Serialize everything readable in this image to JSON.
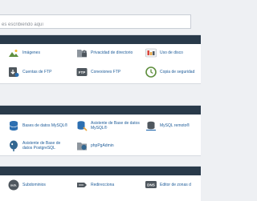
{
  "search": {
    "placeholder": "es escribiendo aquí"
  },
  "files": {
    "items": [
      {
        "label": "Imágenes",
        "icon": "images-icon"
      },
      {
        "label": "Privacidad de directorio",
        "icon": "directory-privacy-icon"
      },
      {
        "label": "Uso de disco",
        "icon": "disk-usage-icon"
      },
      {
        "label": "Cuentas de FTP",
        "icon": "ftp-accounts-icon"
      },
      {
        "label": "Conexiones FTP",
        "icon": "ftp-connections-icon"
      },
      {
        "label": "Copia de seguridad",
        "icon": "backup-icon"
      }
    ]
  },
  "databases": {
    "items": [
      {
        "label": "Bases de datos MySQL®",
        "icon": "mysql-databases-icon"
      },
      {
        "label": "Asistente de Base de datos MySQL®",
        "icon": "mysql-wizard-icon"
      },
      {
        "label": "MySQL remoto®",
        "icon": "remote-mysql-icon"
      },
      {
        "label": "Asistente de Base de datos PostgreSQL",
        "icon": "postgresql-wizard-icon"
      },
      {
        "label": "phpPgAdmin",
        "icon": "phppgadmin-icon"
      }
    ]
  },
  "domains": {
    "items": [
      {
        "label": "Subdominios",
        "icon": "subdomains-icon",
        "icon_text": "sub."
      },
      {
        "label": "Redirecciona",
        "icon": "redirects-icon"
      },
      {
        "label": "Editor de zonas d",
        "icon": "dns-zone-editor-icon",
        "icon_text": "DNS"
      }
    ]
  }
}
